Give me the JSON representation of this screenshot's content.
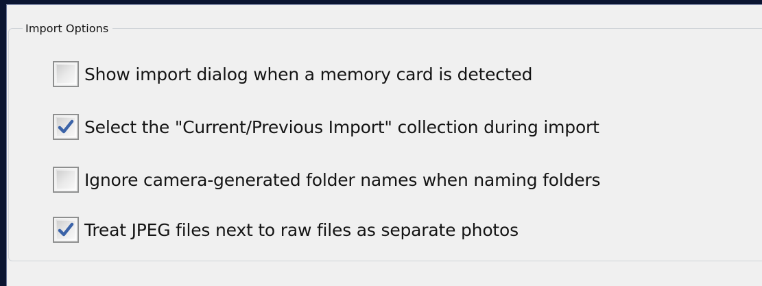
{
  "group": {
    "title": "Import Options"
  },
  "options": [
    {
      "label": "Show import dialog when a memory card is detected",
      "checked": false,
      "icon": "checkbox-unchecked"
    },
    {
      "label": "Select the \"Current/Previous Import\" collection during import",
      "checked": true,
      "icon": "checkmark-icon"
    },
    {
      "label": "Ignore camera-generated folder names when naming folders",
      "checked": false,
      "icon": "checkbox-unchecked"
    },
    {
      "label": "Treat JPEG files next to raw files as separate photos",
      "checked": true,
      "icon": "checkmark-icon"
    }
  ],
  "colors": {
    "frame": "#0b1531",
    "panel": "#f0f0f0",
    "checkmark": "#3b63a8"
  }
}
